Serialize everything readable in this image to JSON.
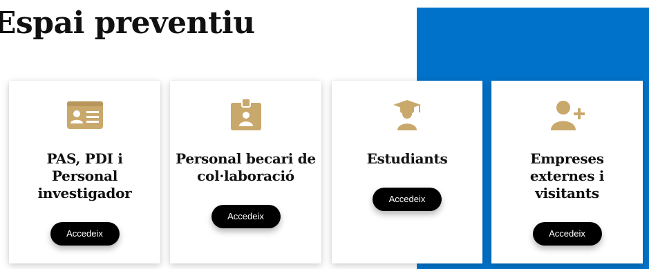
{
  "page": {
    "title": "Espai preventiu"
  },
  "colors": {
    "accent_blue": "#0072c9",
    "icon_gold": "#c9a86c",
    "button_bg": "#000000",
    "button_text": "#ffffff",
    "text_dark": "#111111"
  },
  "cards": [
    {
      "icon": "id-card-icon",
      "title": "PAS, PDI i Personal investigador",
      "button_label": "Accedeix"
    },
    {
      "icon": "badge-icon",
      "title": "Personal becari de col·laboració",
      "button_label": "Accedeix"
    },
    {
      "icon": "graduate-icon",
      "title": "Estudiants",
      "button_label": "Accedeix"
    },
    {
      "icon": "add-user-icon",
      "title": "Empreses externes i visitants",
      "button_label": "Accedeix"
    }
  ]
}
